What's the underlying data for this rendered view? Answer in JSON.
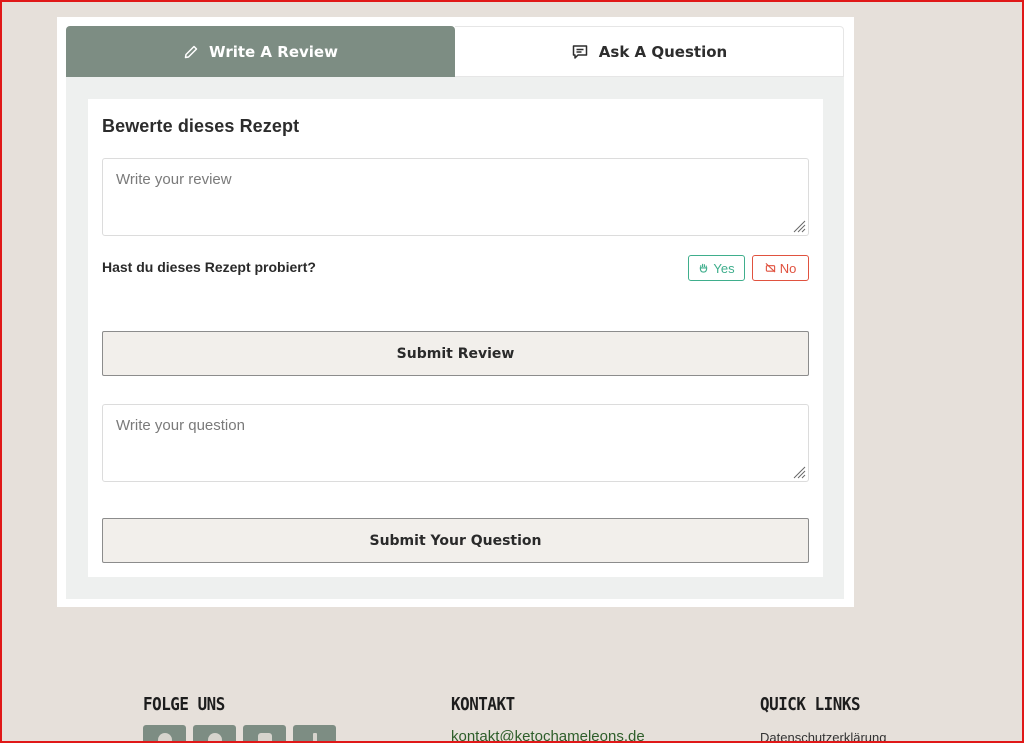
{
  "tabs": {
    "review_label": "Write A Review",
    "question_label": "Ask A Question"
  },
  "review_form": {
    "heading": "Bewerte dieses Rezept",
    "review_placeholder": "Write your review",
    "tried_question": "Hast du dieses Rezept probiert?",
    "yes_label": "Yes",
    "no_label": "No",
    "submit_label": "Submit Review"
  },
  "question_form": {
    "question_placeholder": "Write your question",
    "submit_label": "Submit Your Question"
  },
  "footer": {
    "social_heading": "FOLGE UNS",
    "contact_heading": "KONTAKT",
    "contact_email": "kontakt@ketochameleons.de",
    "quick_links_heading": "QUICK LINKS",
    "quick_link_first": "Datenschutzerklärung"
  },
  "colors": {
    "accent": "#7d8d83",
    "yes": "#3fae8c",
    "no": "#e0523f",
    "page_bg": "#e6e0da"
  }
}
